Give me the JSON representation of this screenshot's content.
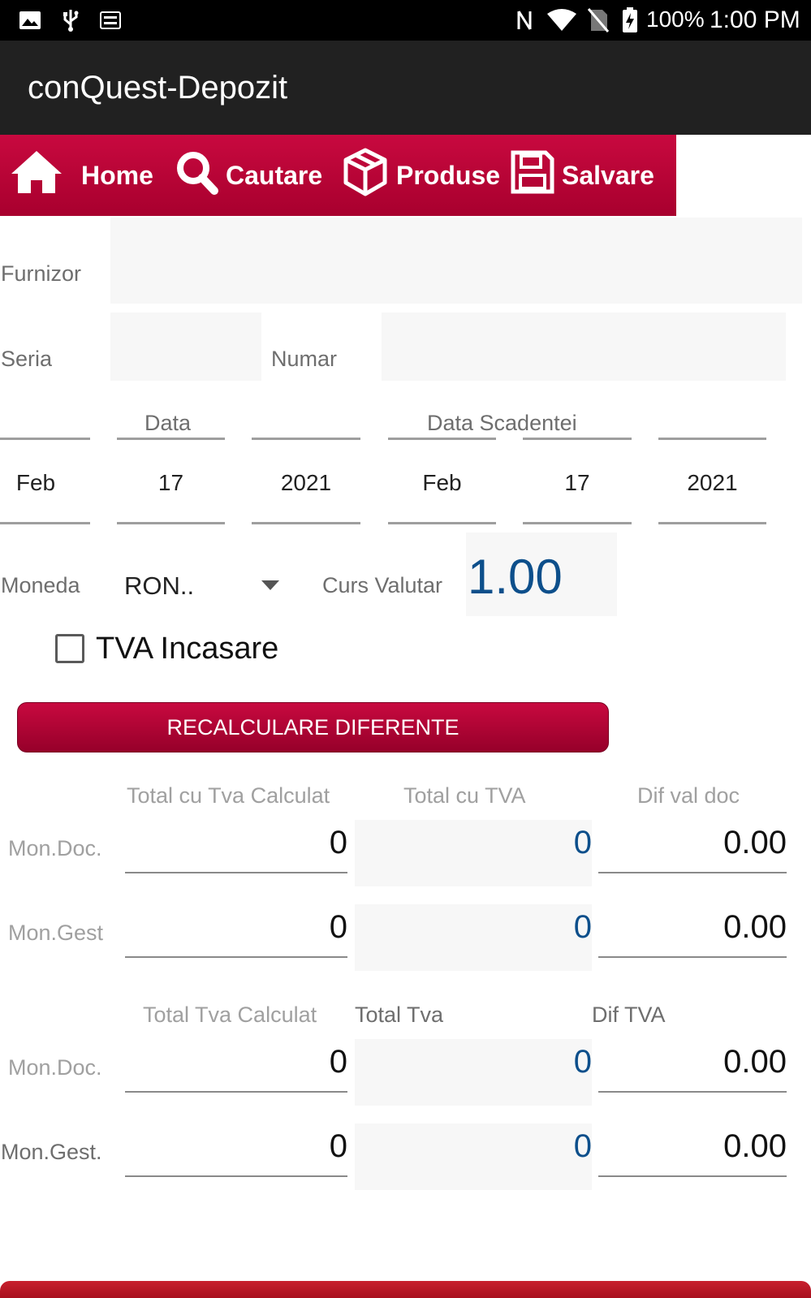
{
  "status_bar": {
    "battery": "100%",
    "time": "1:00 PM",
    "icons": [
      "image-icon",
      "usb-icon",
      "keyboard-icon",
      "nfc-icon",
      "wifi-icon",
      "no-sim-icon",
      "battery-charging-icon"
    ]
  },
  "app_bar": {
    "title": "conQuest-Depozit"
  },
  "nav": {
    "items": [
      {
        "label": "Home",
        "icon": "home-icon"
      },
      {
        "label": "Cautare",
        "icon": "search-icon"
      },
      {
        "label": "Produse",
        "icon": "box-icon"
      },
      {
        "label": "Salvare",
        "icon": "save-icon"
      }
    ]
  },
  "form": {
    "furnizor_label": "Furnizor",
    "furnizor_value": "",
    "seria_label": "Seria",
    "seria_value": "",
    "numar_label": "Numar",
    "numar_value": "",
    "data_label": "Data",
    "data_scadentei_label": "Data Scadentei",
    "data": {
      "month": "Feb",
      "day": "17",
      "year": "2021"
    },
    "data_scadentei": {
      "month": "Feb",
      "day": "17",
      "year": "2021"
    },
    "moneda_label": "Moneda",
    "moneda_value": "RON..",
    "curs_label": "Curs Valutar",
    "curs_value": "1.00",
    "tva_incasare_label": "TVA Incasare",
    "tva_incasare_checked": false,
    "recalc_label": "RECALCULARE DIFERENTE"
  },
  "totals": {
    "headers": [
      "Total cu Tva Calculat",
      "Total cu TVA",
      "Dif val doc"
    ],
    "rows": [
      {
        "label": "Mon.Doc.",
        "calc": "0",
        "total": "0",
        "dif": "0.00"
      },
      {
        "label": "Mon.Gest",
        "calc": "0",
        "total": "0",
        "dif": "0.00"
      }
    ]
  },
  "tva": {
    "headers": [
      "Total Tva Calculat",
      "Total Tva",
      "Dif TVA"
    ],
    "rows": [
      {
        "label": "Mon.Doc.",
        "calc": "0",
        "total": "0",
        "dif": "0.00"
      },
      {
        "label": "Mon.Gest.",
        "calc": "0",
        "total": "0",
        "dif": "0.00"
      }
    ]
  },
  "colors": {
    "accent": "#b8073a",
    "appbar": "#212121",
    "value_blue": "#0d4f8b"
  }
}
